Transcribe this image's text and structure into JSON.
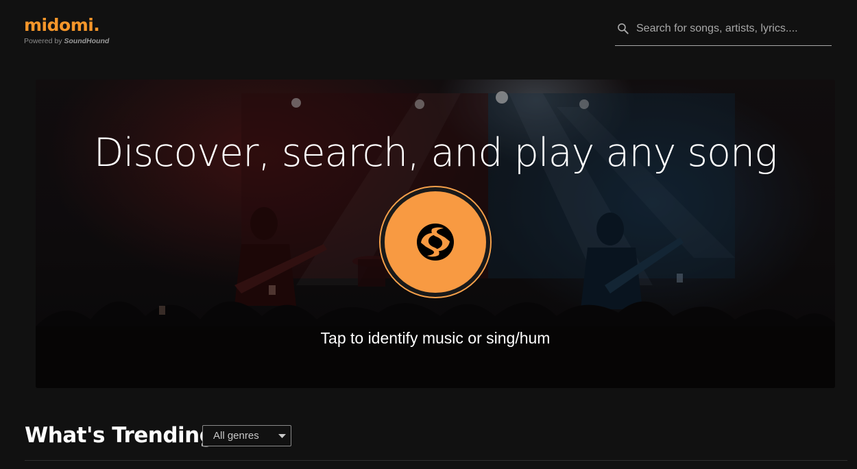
{
  "header": {
    "logo_text": "midomi.",
    "tagline_prefix": "Powered by",
    "tagline_brand": "SoundHound",
    "search": {
      "placeholder": "Search for songs, artists, lyrics....",
      "value": ""
    }
  },
  "hero": {
    "title": "Discover, search, and play any song",
    "caption": "Tap to identify music or sing/hum"
  },
  "trending": {
    "title": "What's Trending",
    "genre_selected": "All genres"
  },
  "icons": {
    "search": "search-icon",
    "listen": "soundhound-logo-icon",
    "dropdown": "caret-down-icon"
  },
  "colors": {
    "background": "#111111",
    "accent_orange": "#f89a42",
    "text_primary": "#ffffff",
    "text_muted": "#a8a8a8"
  }
}
